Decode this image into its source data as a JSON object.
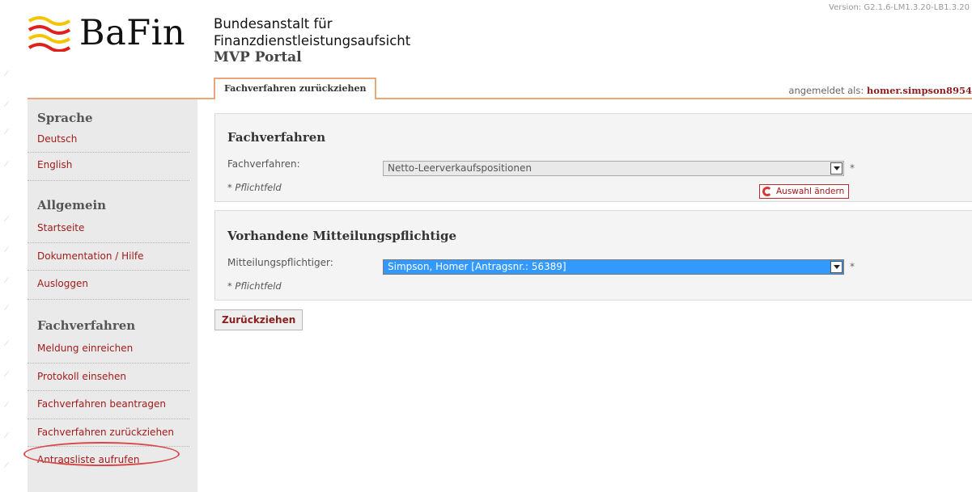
{
  "header": {
    "logo_text": "BaFin",
    "org_name_line1": "Bundesanstalt für",
    "org_name_line2": "Finanzdienstleistungsaufsicht",
    "portal_name": "MVP Portal",
    "version": "Version: G2.1.6-LM1.3.20-LB1.3.20"
  },
  "tabs": {
    "active": "Fachverfahren zurückziehen"
  },
  "user": {
    "prefix": "angemeldet als:",
    "name": "homer.simpson8954"
  },
  "sidebar": {
    "sections": [
      {
        "title": "Sprache",
        "items": [
          "Deutsch",
          "English"
        ]
      },
      {
        "title": "Allgemein",
        "items": [
          "Startseite",
          "Dokumentation / Hilfe",
          "Ausloggen"
        ]
      },
      {
        "title": "Fachverfahren",
        "items": [
          "Meldung einreichen",
          "Protokoll einsehen",
          "Fachverfahren beantragen",
          "Fachverfahren zurückziehen",
          "Antragsliste aufrufen"
        ]
      }
    ],
    "selected_item": "Fachverfahren zurückziehen"
  },
  "fachverfahren_panel": {
    "title": "Fachverfahren",
    "label": "Fachverfahren:",
    "selected_value": "Netto-Leerverkaufspositionen",
    "required_star": "*",
    "required_note": "* Pflichtfeld",
    "change_button": "Auswahl ändern"
  },
  "mitteilungspflichtige_panel": {
    "title": "Vorhandene Mitteilungspflichtige",
    "label": "Mitteilungspflichtiger:",
    "selected_value": "Simpson, Homer [Antragsnr.: 56389]",
    "required_star": "*",
    "required_note": "* Pflichtfeld"
  },
  "actions": {
    "submit": "Zurückziehen"
  },
  "colors": {
    "accent": "#a21b1b",
    "tab_border": "#e8a679",
    "sidebar_bg": "#eaeaea",
    "highlight": "#d94848",
    "select_active": "#3399ff"
  }
}
